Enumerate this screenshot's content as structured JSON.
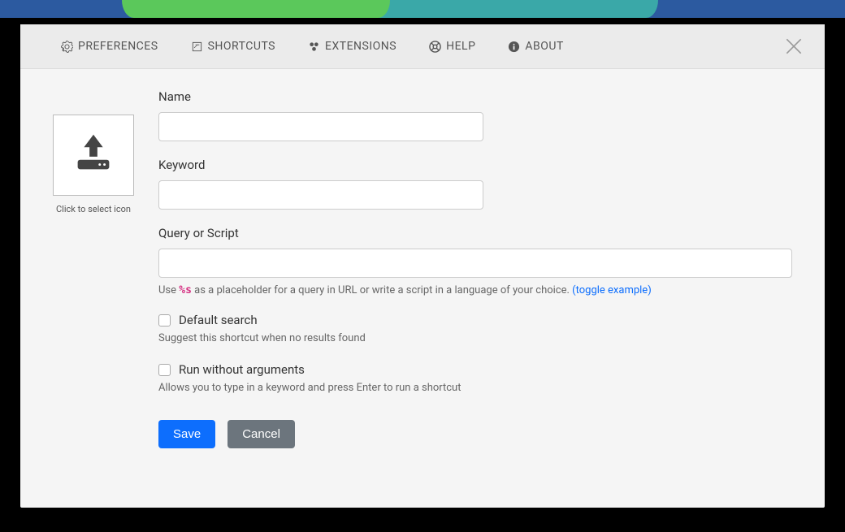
{
  "tabs": {
    "preferences": "PREFERENCES",
    "shortcuts": "SHORTCUTS",
    "extensions": "EXTENSIONS",
    "help": "HELP",
    "about": "ABOUT"
  },
  "icon_picker": {
    "hint": "Click to select icon"
  },
  "fields": {
    "name": {
      "label": "Name",
      "value": ""
    },
    "keyword": {
      "label": "Keyword",
      "value": ""
    },
    "query": {
      "label": "Query or Script",
      "value": "",
      "hint_prefix": "Use ",
      "hint_token": "%s",
      "hint_suffix": " as a placeholder for a query in URL or write a script in a language of your choice. ",
      "hint_link": "(toggle example)"
    }
  },
  "checkboxes": {
    "default_search": {
      "label": "Default search",
      "hint": "Suggest this shortcut when no results found",
      "checked": false
    },
    "run_without_args": {
      "label": "Run without arguments",
      "hint": "Allows you to type in a keyword and press Enter to run a shortcut",
      "checked": false
    }
  },
  "buttons": {
    "save": "Save",
    "cancel": "Cancel"
  }
}
